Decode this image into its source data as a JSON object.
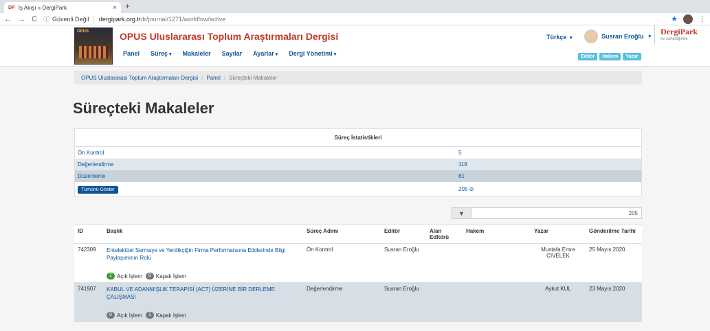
{
  "browser": {
    "tab_favicon": "DP",
    "tab_title": "İş Akışı » DergiPark",
    "tab_close": "×",
    "new_tab": "+",
    "back": "←",
    "forward": "→",
    "reload": "C",
    "info_icon": "ⓘ",
    "security_label": "Güvenli Değil",
    "url_domain": "dergipark.org.tr",
    "url_path": "/tr/journal/1271/workflow/active",
    "star": "★",
    "kebab": "⋮"
  },
  "header": {
    "logo_text": "OPUS",
    "journal_title": "OPUS Uluslararası Toplum Araştırmaları Dergisi",
    "nav": [
      {
        "label": "Panel",
        "caret": ""
      },
      {
        "label": "Süreç",
        "caret": "▾"
      },
      {
        "label": "Makaleler",
        "caret": ""
      },
      {
        "label": "Sayılar",
        "caret": ""
      },
      {
        "label": "Ayarlar",
        "caret": "▾"
      },
      {
        "label": "Dergi Yönetimi",
        "caret": "▾"
      }
    ],
    "language": "Türkçe",
    "language_caret": "▾",
    "user_name": "Susran Eroğlu",
    "user_caret": "▾",
    "roles": [
      "Editör",
      "Hakem",
      "Yazar"
    ],
    "brand_title": "DergiPark",
    "brand_sub": "ev sahipliğinde"
  },
  "breadcrumb": [
    "OPUS Uluslararası Toplum Araştırmaları Dergisi",
    "Panel",
    "Süreçteki Makaleler"
  ],
  "breadcrumb_sep": "/",
  "page_title": "Süreçteki Makaleler",
  "stats": {
    "title": "Süreç İstatistikleri",
    "rows": [
      {
        "label": "Ön Kontrol",
        "value": "5"
      },
      {
        "label": "Değerlendirme",
        "value": "119"
      },
      {
        "label": "Düzenleme",
        "value": "81"
      }
    ],
    "show_all_label": "Tümünü Göster",
    "total": "205",
    "total_icon": "⊘"
  },
  "filter": {
    "icon": "▼",
    "count": "205"
  },
  "table": {
    "headers": [
      "ID",
      "Başlık",
      "Süreç Adımı",
      "Editör",
      "Alan Editörü",
      "Hakem",
      "Yazar",
      "Gönderilme Tarihi"
    ],
    "rows": [
      {
        "id": "742309",
        "title": "Entelektüel Sermaye ve Yenilikçiğin Firma Performansına Etkilerinde Bilgi Paylaşımının Rolü",
        "step": "Ön Kontrol",
        "editor": "Susran Eroğlu",
        "field_editor": "",
        "reviewer": "",
        "author": "Mustafa Emre CİVELEK",
        "date": "25 Mayıs 2020",
        "open_count": "1",
        "open_label": "Açık İşlem",
        "closed_count": "0",
        "closed_label": "Kapalı İşlem"
      },
      {
        "id": "741907",
        "title": "KABUL VE ADANMIŞLIK TERAPİSİ (ACT) ÜZERİNE BİR DERLEME ÇALIŞMASI",
        "step": "Değerlendirme",
        "editor": "Susran Eroğlu",
        "field_editor": "",
        "reviewer": "",
        "author": "Aykut KUL",
        "date": "23 Mayıs 2020",
        "open_count": "0",
        "open_label": "Açık İşlem",
        "closed_count": "1",
        "closed_label": "Kapalı İşlem"
      }
    ]
  }
}
